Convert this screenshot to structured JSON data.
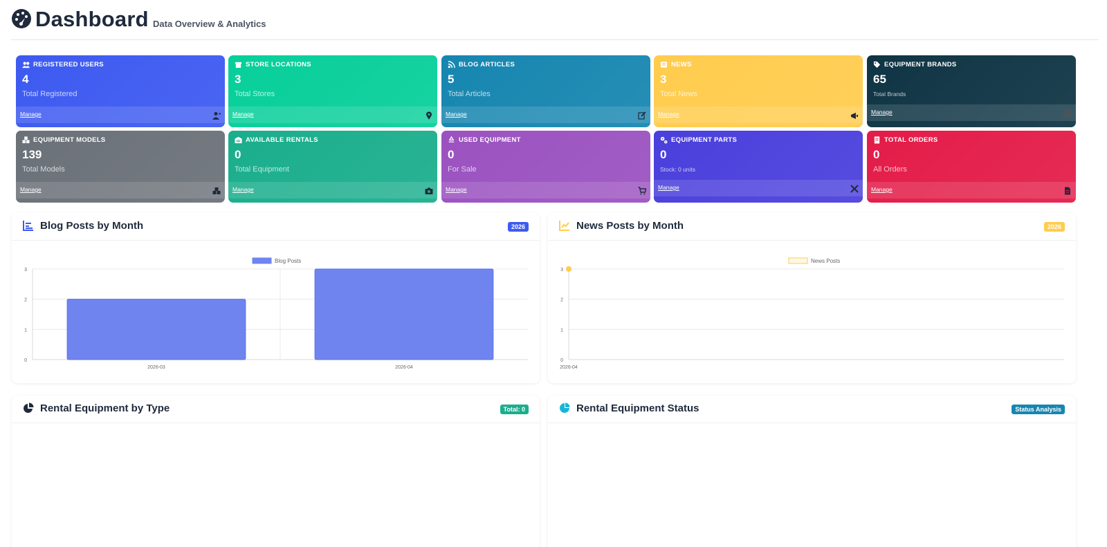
{
  "header": {
    "title": "Dashboard",
    "subtitle": "Data Overview & Analytics"
  },
  "cards": [
    {
      "title": "Registered Users",
      "value": "4",
      "label": "Total Registered",
      "manage": "Manage",
      "color": "#3d5af1",
      "icon": "users-icon",
      "footer_icon": "user-plus-icon"
    },
    {
      "title": "Store Locations",
      "value": "3",
      "label": "Total Stores",
      "manage": "Manage",
      "color": "#07cf9a",
      "icon": "store-icon",
      "footer_icon": "map-pin-icon"
    },
    {
      "title": "Blog Articles",
      "value": "5",
      "label": "Total Articles",
      "manage": "Manage",
      "color": "#1686b0",
      "icon": "rss-icon",
      "footer_icon": "edit-icon"
    },
    {
      "title": "News",
      "value": "3",
      "label": "Total News",
      "manage": "Manage",
      "color": "#ffcc4d",
      "icon": "newspaper-icon",
      "footer_icon": "megaphone-icon"
    },
    {
      "title": "Equipment Brands",
      "value": "65",
      "label": "Total Brands",
      "manage": "Manage",
      "color": "#0f3444",
      "icon": "tags-icon",
      "footer_icon": "copyright-icon"
    },
    {
      "title": "Equipment Models",
      "value": "139",
      "label": "Total Models",
      "manage": "Manage",
      "color": "#6b7178",
      "icon": "cubes-icon",
      "footer_icon": "boxes-icon"
    },
    {
      "title": "Available Rentals",
      "value": "0",
      "label": "Total Equipment",
      "manage": "Manage",
      "color": "#1aae8c",
      "icon": "warehouse-icon",
      "footer_icon": "camera-icon"
    },
    {
      "title": "Used Equipment",
      "value": "0",
      "label": "For Sale",
      "manage": "Manage",
      "color": "#9b52c0",
      "icon": "recycle-icon",
      "footer_icon": "cart-icon"
    },
    {
      "title": "Equipment Parts",
      "value": "0",
      "label": "Stock: 0 units",
      "manage": "Manage",
      "color": "#4a3fdc",
      "icon": "gears-icon",
      "footer_icon": "tools-icon"
    },
    {
      "title": "Total Orders",
      "value": "0",
      "label": "All Orders",
      "manage": "Manage",
      "color": "#e31c48",
      "icon": "receipt-icon",
      "footer_icon": "file-icon"
    }
  ],
  "panels": {
    "blog": {
      "title": "Blog Posts by Month",
      "badge": "2026",
      "badge_color": "#3d5af1",
      "icon": "bar-chart-icon"
    },
    "news": {
      "title": "News Posts by Month",
      "badge": "2026",
      "badge_color": "#ffcc4d",
      "icon": "line-chart-icon"
    },
    "rental_type": {
      "title": "Rental Equipment by Type",
      "badge": "Total: 0",
      "badge_color": "#1aae8c",
      "icon": "pie-chart-icon"
    },
    "rental_status": {
      "title": "Rental Equipment Status",
      "badge": "Status Analysis",
      "badge_color": "#1686b0",
      "icon": "pie-chart-icon"
    }
  },
  "chart_data": [
    {
      "type": "bar",
      "title": "",
      "categories": [
        "2026-03",
        "2026-04"
      ],
      "series": [
        {
          "name": "Blog Posts",
          "values": [
            2,
            3
          ],
          "color": "#6f84ef"
        }
      ],
      "ylim": [
        0,
        3
      ],
      "yticks": [
        0,
        1,
        2,
        3
      ],
      "grid": true,
      "legend": "top-center"
    },
    {
      "type": "line",
      "title": "",
      "categories": [
        "2026-04"
      ],
      "series": [
        {
          "name": "News Posts",
          "values": [
            3
          ],
          "color": "#ffcc4d"
        }
      ],
      "ylim": [
        0,
        3
      ],
      "yticks": [
        0,
        1,
        2,
        3
      ],
      "grid": true,
      "legend": "top-center"
    }
  ]
}
